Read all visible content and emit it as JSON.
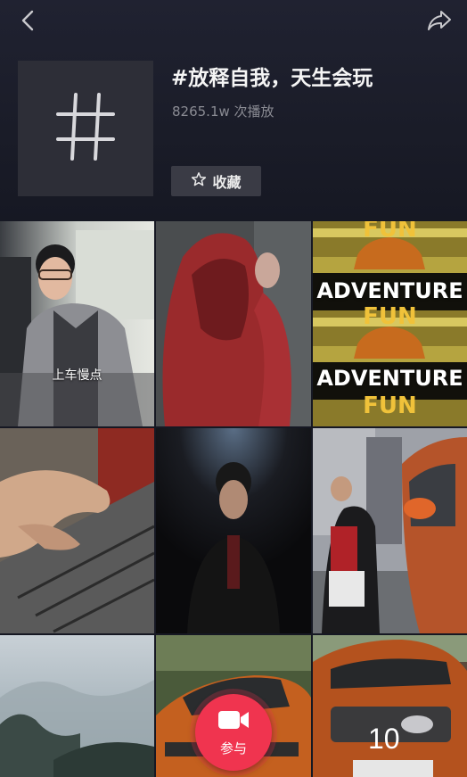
{
  "header": {
    "title": "#放释自我，天生会玩",
    "plays_value": "8265.1w",
    "plays_suffix": "次播放",
    "favorite_label": "收藏"
  },
  "icons": {
    "back": "chevron-left-icon",
    "share": "share-arrow-icon",
    "cover": "hashtag-icon",
    "favorite": "star-outline-icon",
    "join": "video-camera-icon"
  },
  "grid": {
    "videos": [
      {
        "caption": "上车慢点"
      },
      {
        "caption": ""
      },
      {
        "overlay_lines": [
          "FUN",
          "ADVENTURE",
          "FUN",
          "ADVENTURE",
          "FUN"
        ]
      },
      {
        "caption": ""
      },
      {
        "caption": ""
      },
      {
        "caption": ""
      },
      {
        "caption": ""
      },
      {
        "caption": ""
      },
      {
        "plate": "10"
      }
    ]
  },
  "join_button": {
    "label": "参与"
  },
  "colors": {
    "background": "#161823",
    "accent": "#f0344f",
    "button_bg": "#3a3b45",
    "cover_bg": "#2d2e37"
  }
}
